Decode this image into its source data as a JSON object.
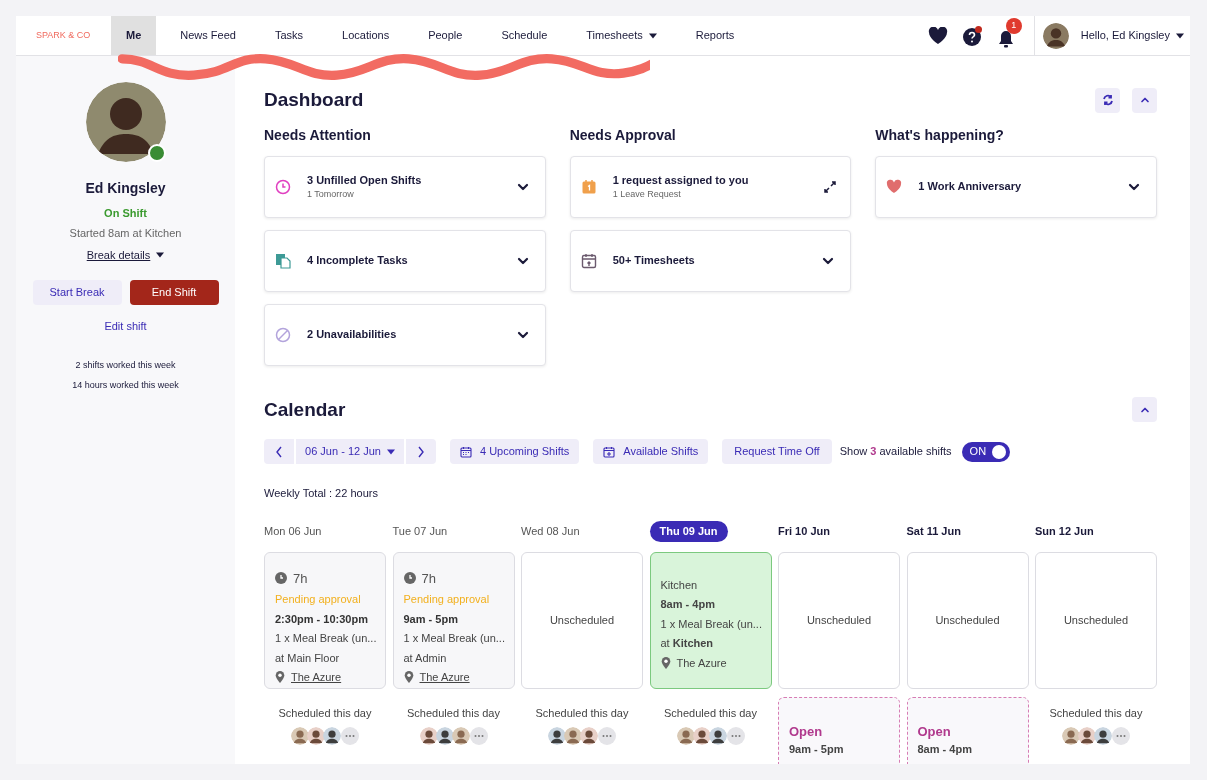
{
  "brand": "SPARK & CO",
  "nav": [
    {
      "label": "Me",
      "selected": true,
      "dropdown": false
    },
    {
      "label": "News Feed",
      "selected": false,
      "dropdown": false
    },
    {
      "label": "Tasks",
      "selected": false,
      "dropdown": false
    },
    {
      "label": "Locations",
      "selected": false,
      "dropdown": false
    },
    {
      "label": "People",
      "selected": false,
      "dropdown": false
    },
    {
      "label": "Schedule",
      "selected": false,
      "dropdown": false
    },
    {
      "label": "Timesheets",
      "selected": false,
      "dropdown": true
    },
    {
      "label": "Reports",
      "selected": false,
      "dropdown": false
    }
  ],
  "notifications_badge": "1",
  "greeting": "Hello, Ed Kingsley",
  "profile": {
    "name": "Ed Kingsley",
    "status": "On Shift",
    "online": true,
    "started": "Started 8am at Kitchen",
    "break_details": "Break details",
    "start_break": "Start Break",
    "end_shift": "End Shift",
    "edit_shift": "Edit shift",
    "stats": [
      "2 shifts worked this week",
      "14 hours worked this week"
    ]
  },
  "dashboard": {
    "title": "Dashboard",
    "sections": [
      {
        "title": "Needs Attention",
        "cards": [
          {
            "kind": "clock",
            "title": "3 Unfilled Open Shifts",
            "subtitle": "1 Tomorrow",
            "expandable": true
          },
          {
            "kind": "tasks",
            "title": "4 Incomplete Tasks",
            "expandable": true
          },
          {
            "kind": "blocked",
            "title": "2 Unavailabilities",
            "expandable": true
          }
        ]
      },
      {
        "title": "Needs Approval",
        "cards": [
          {
            "kind": "request",
            "title": "1 request assigned to you",
            "subtitle": "1 Leave Request",
            "expandable": false
          },
          {
            "kind": "timesheet",
            "title": "50+ Timesheets",
            "expandable": true
          }
        ]
      },
      {
        "title": "What's happening?",
        "cards": [
          {
            "kind": "anniversary",
            "title": "1 Work Anniversary",
            "expandable": true
          }
        ]
      }
    ]
  },
  "calendar": {
    "title": "Calendar",
    "range": "06 Jun - 12 Jun",
    "upcoming": "4 Upcoming Shifts",
    "available": "Available Shifts",
    "time_off": "Request Time Off",
    "toggle": {
      "prefix": "Show",
      "count": "3",
      "suffix": "available shifts",
      "on": true,
      "label": "ON"
    },
    "weekly_total": "Weekly Total : 22 hours",
    "days": [
      {
        "label": "Mon 06 Jun",
        "selected": false,
        "past": true,
        "card": {
          "kind": "pending",
          "hours": "7h",
          "status": "Pending approval",
          "time": "2:30pm - 10:30pm",
          "break": "1 x Meal Break (un...",
          "at": "at Main Floor",
          "place": "The Azure"
        },
        "below": {
          "kind": "scheduled",
          "text": "Scheduled this day"
        }
      },
      {
        "label": "Tue 07 Jun",
        "selected": false,
        "past": true,
        "card": {
          "kind": "pending",
          "hours": "7h",
          "status": "Pending approval",
          "time": "9am - 5pm",
          "break": "1 x Meal Break (un...",
          "at": "at Admin",
          "place": "The Azure"
        },
        "below": {
          "kind": "scheduled",
          "text": "Scheduled this day"
        }
      },
      {
        "label": "Wed 08 Jun",
        "selected": false,
        "past": true,
        "card": {
          "kind": "unscheduled",
          "text": "Unscheduled"
        },
        "below": {
          "kind": "scheduled",
          "text": "Scheduled this day"
        }
      },
      {
        "label": "Thu 09 Jun",
        "selected": true,
        "card": {
          "kind": "active",
          "area": "Kitchen",
          "time": "8am - 4pm",
          "break": "1 x Meal Break (un...",
          "at_prefix": "at",
          "at": "Kitchen",
          "place": "The Azure"
        },
        "below": {
          "kind": "scheduled",
          "text": "Scheduled this day"
        }
      },
      {
        "label": "Fri 10 Jun",
        "selected": false,
        "past": false,
        "card": {
          "kind": "unscheduled",
          "text": "Unscheduled"
        },
        "below": {
          "kind": "open",
          "title": "Open",
          "time": "9am - 5pm"
        }
      },
      {
        "label": "Sat 11 Jun",
        "selected": false,
        "past": false,
        "card": {
          "kind": "unscheduled",
          "text": "Unscheduled"
        },
        "below": {
          "kind": "open",
          "title": "Open",
          "time": "8am - 4pm"
        }
      },
      {
        "label": "Sun 12 Jun",
        "selected": false,
        "past": false,
        "card": {
          "kind": "unscheduled",
          "text": "Unscheduled"
        },
        "below": {
          "kind": "scheduled",
          "text": "Scheduled this day"
        }
      }
    ]
  }
}
